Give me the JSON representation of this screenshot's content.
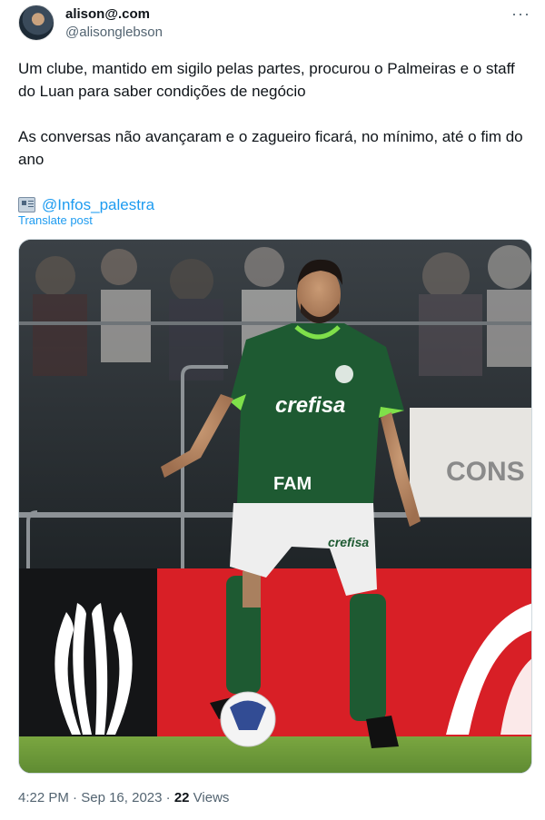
{
  "author": {
    "display_name": "alison@.com",
    "handle": "@alisonglebson"
  },
  "more_label": "···",
  "tweet": {
    "paragraph_1": "Um clube, mantido em sigilo pelas partes, procurou o Palmeiras e o staff do Luan para saber condições de negócio",
    "paragraph_2": "As conversas não avançaram e o zagueiro ficará, no mínimo, até o fim do ano",
    "source_icon": "newspaper-icon",
    "mention": "@Infos_palestra"
  },
  "translate_label": "Translate post",
  "media": {
    "shirt_sponsor": "crefisa",
    "shirt_secondary_sponsor": "FAM",
    "shorts_sponsor": "crefisa",
    "banner_text": "CONS",
    "colors": {
      "kit_green": "#1e5a32",
      "collar_green": "#7fe04a",
      "board_red": "#d81f26",
      "pitch_green": "#6e9a3a"
    }
  },
  "meta": {
    "time": "4:22 PM",
    "separator": "·",
    "date": "Sep 16, 2023",
    "views_count": "22",
    "views_label": "Views"
  }
}
